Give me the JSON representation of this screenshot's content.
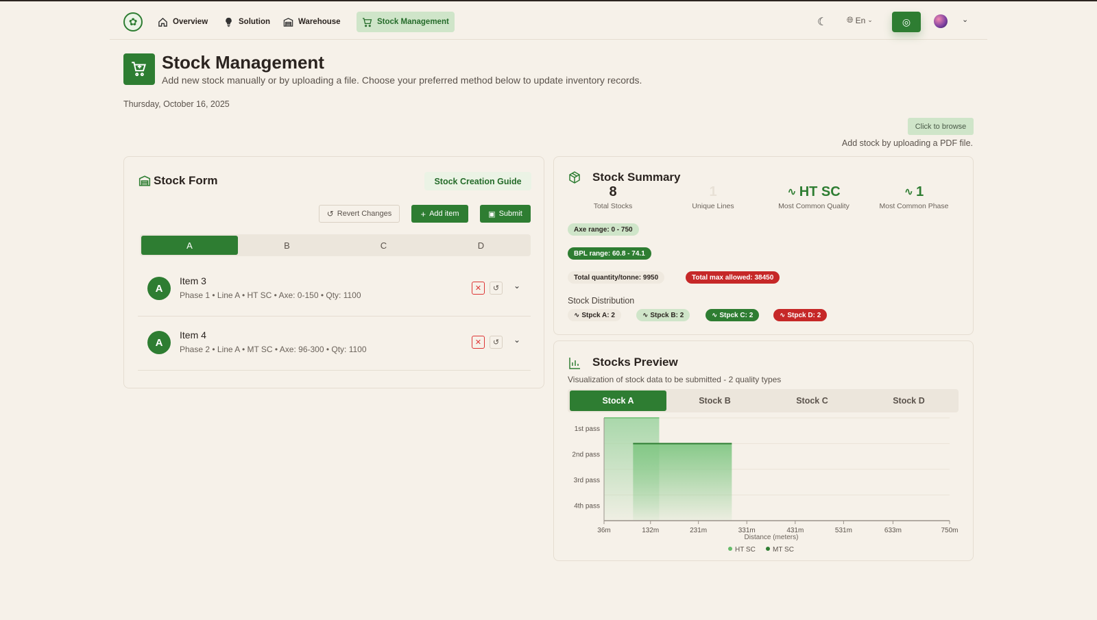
{
  "nav": {
    "items": [
      {
        "label": "Overview",
        "icon": "home-icon"
      },
      {
        "label": "Solution",
        "icon": "lightbulb-icon"
      },
      {
        "label": "Warehouse",
        "icon": "warehouse-icon"
      },
      {
        "label": "Stock Management",
        "icon": "cart-icon",
        "active": true
      }
    ],
    "lang": "En"
  },
  "header": {
    "title": "Stock Management",
    "subtitle": "Add new stock manually or by uploading a file. Choose your preferred method below to update inventory records.",
    "date": "Thursday, October 16, 2025",
    "browse_label": "Click to browse",
    "upload_hint": "Add stock by uploading a PDF file."
  },
  "form": {
    "title": "Stock Form",
    "guide_label": "Stock Creation Guide",
    "revert_label": "Revert Changes",
    "add_label": "Add item",
    "submit_label": "Submit",
    "tabs": [
      "A",
      "B",
      "C",
      "D"
    ],
    "active_tab": 0,
    "items": [
      {
        "avatar": "A",
        "name": "Item 3",
        "meta": "Phase 1 • Line A • HT SC • Axe: 0-150 • Qty: 1100"
      },
      {
        "avatar": "A",
        "name": "Item 4",
        "meta": "Phase 2 • Line A • MT SC • Axe: 96-300 • Qty: 1100"
      }
    ]
  },
  "summary": {
    "title": "Stock Summary",
    "stats": [
      {
        "value": "8",
        "label": "Total Stocks"
      },
      {
        "value": "1",
        "label": "Unique Lines"
      },
      {
        "value": "HT SC",
        "label": "Most Common Quality"
      },
      {
        "value": "1",
        "label": "Most Common Phase"
      }
    ],
    "axe_range": "Axe range: 0 - 750",
    "bpl_range": "BPL range: 60.8 - 74.1",
    "total_qty": "Total quantity/tonne: 9950",
    "total_max": "Total max allowed: 38450",
    "distribution_label": "Stock Distribution",
    "distribution": [
      {
        "label": "Stpck A: 2",
        "style": "beige"
      },
      {
        "label": "Stpck B: 2",
        "style": "light"
      },
      {
        "label": "Stpck C: 2",
        "style": "dark"
      },
      {
        "label": "Stpck D: 2",
        "style": "red"
      }
    ]
  },
  "preview": {
    "title": "Stocks Preview",
    "subtitle": "Visualization of stock data to be submitted - 2 quality types",
    "tabs": [
      "Stock A",
      "Stock B",
      "Stock C",
      "Stock D"
    ],
    "active_tab": 0
  },
  "chart_data": {
    "type": "bar",
    "xlabel": "Distance (meters)",
    "x_ticks": [
      "36m",
      "132m",
      "231m",
      "331m",
      "431m",
      "531m",
      "633m",
      "750m"
    ],
    "y_ticks": [
      "1st pass",
      "2nd pass",
      "3rd pass",
      "4th pass"
    ],
    "series": [
      {
        "name": "HT SC",
        "x_start": 0,
        "x_end": 150,
        "pass": "1st pass",
        "color": "#a5d6a7"
      },
      {
        "name": "MT SC",
        "x_start": 96,
        "x_end": 300,
        "pass": "2nd pass",
        "color": "#81c784"
      }
    ],
    "colors": {
      "accent": "#2e7d32",
      "danger": "#c62828"
    }
  }
}
